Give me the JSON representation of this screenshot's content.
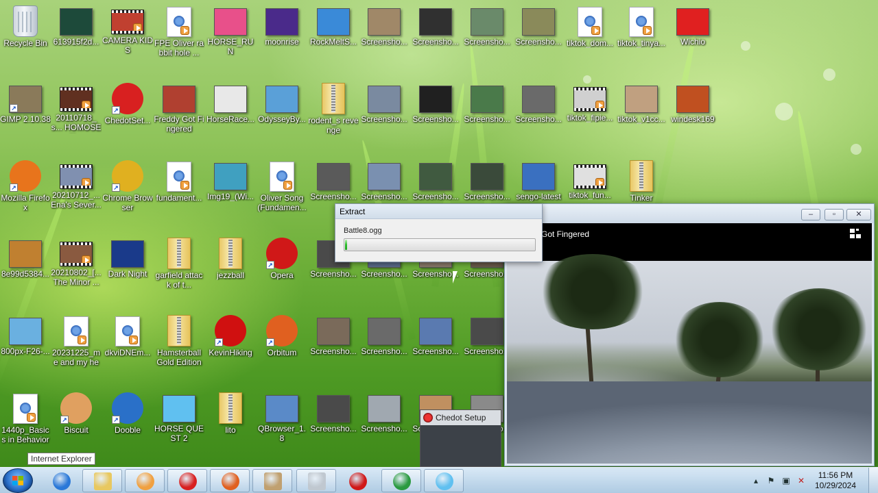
{
  "desktop": {
    "icons": [
      {
        "label": "Recycle Bin",
        "kind": "bin",
        "color": "#d8dee6"
      },
      {
        "label": "613915f2d...",
        "kind": "thumb",
        "color": "#1d4a3a"
      },
      {
        "label": "CAMERA KIDS",
        "kind": "video",
        "color": "#c04030"
      },
      {
        "label": "FPE Oliver rabbit hole ...",
        "kind": "doc",
        "color": "#ffffff"
      },
      {
        "label": "HORSE_RUN",
        "kind": "thumb",
        "color": "#e8508a"
      },
      {
        "label": "moonrise",
        "kind": "thumb",
        "color": "#4a2a8a"
      },
      {
        "label": "RockMeltS...",
        "kind": "thumb",
        "color": "#3a8ad8"
      },
      {
        "label": "Screensho...",
        "kind": "thumb",
        "color": "#a08868"
      },
      {
        "label": "Screensho...",
        "kind": "thumb",
        "color": "#303030"
      },
      {
        "label": "Screensho...",
        "kind": "thumb",
        "color": "#6a8a6a"
      },
      {
        "label": "Screensho...",
        "kind": "thumb",
        "color": "#8a8a5a"
      },
      {
        "label": "tiktok_dom...",
        "kind": "doc",
        "color": "#ffffff"
      },
      {
        "label": "tiktok_tinya...",
        "kind": "doc",
        "color": "#ffffff"
      },
      {
        "label": "Wichio",
        "kind": "thumb",
        "color": "#e02020"
      },
      {
        "label": "GIMP 2.10.38",
        "kind": "thumb",
        "color": "#8a7a5a"
      },
      {
        "label": "20110718_s... HOMOSEX...",
        "kind": "video",
        "color": "#603020"
      },
      {
        "label": "ChedotSet...",
        "kind": "round",
        "color": "#d82020"
      },
      {
        "label": "Freddy Got Fingered",
        "kind": "thumb",
        "color": "#b04030"
      },
      {
        "label": "HorseRace...",
        "kind": "thumb",
        "color": "#e8e8e8"
      },
      {
        "label": "OdysseyBy...",
        "kind": "thumb",
        "color": "#5aa0d8"
      },
      {
        "label": "rodent_s revenge",
        "kind": "folder",
        "color": "#f0d080"
      },
      {
        "label": "Screensho...",
        "kind": "thumb",
        "color": "#7a8aa0"
      },
      {
        "label": "Screensho...",
        "kind": "thumb",
        "color": "#202020"
      },
      {
        "label": "Screensho...",
        "kind": "thumb",
        "color": "#4a7a4a"
      },
      {
        "label": "Screensho...",
        "kind": "thumb",
        "color": "#6a6a6a"
      },
      {
        "label": "tiktok_fipie...",
        "kind": "video",
        "color": "#d0d0d0"
      },
      {
        "label": "tiktok_v1cc...",
        "kind": "thumb",
        "color": "#c0a080"
      },
      {
        "label": "windesk169",
        "kind": "thumb",
        "color": "#c05020"
      },
      {
        "label": "Mozilla Firefox",
        "kind": "round",
        "color": "#e8741c"
      },
      {
        "label": "20210712_... Ena's Sever...",
        "kind": "video",
        "color": "#8090b0"
      },
      {
        "label": "Chrome Browser",
        "kind": "round",
        "color": "#e0b020"
      },
      {
        "label": "fundament...",
        "kind": "doc",
        "color": "#ffffff"
      },
      {
        "label": "Img19_(Wi...",
        "kind": "thumb",
        "color": "#40a0c0"
      },
      {
        "label": "Oliver Song (Fundamen...",
        "kind": "doc",
        "color": "#ffffff"
      },
      {
        "label": "Screensho...",
        "kind": "thumb",
        "color": "#5a5a5a"
      },
      {
        "label": "Screensho...",
        "kind": "thumb",
        "color": "#7a90b0"
      },
      {
        "label": "Screensho...",
        "kind": "thumb",
        "color": "#405a40"
      },
      {
        "label": "Screensho...",
        "kind": "thumb",
        "color": "#3a4a3a"
      },
      {
        "label": "sengo-latest",
        "kind": "thumb",
        "color": "#3a70c0"
      },
      {
        "label": "tiktok_fun...",
        "kind": "video",
        "color": "#e0e0e0"
      },
      {
        "label": "Tinker",
        "kind": "folder",
        "color": "#f0d080"
      },
      {
        "label": "8e99d5384...",
        "kind": "thumb",
        "color": "#c08030"
      },
      {
        "label": "20210802_[... The Minor ...",
        "kind": "video",
        "color": "#8a5a40"
      },
      {
        "label": "Dark Night",
        "kind": "thumb",
        "color": "#1a3a8a"
      },
      {
        "label": "garfield attack of t...",
        "kind": "folder",
        "color": "#f0d080"
      },
      {
        "label": "jezzball",
        "kind": "folder",
        "color": "#f0d080"
      },
      {
        "label": "Opera",
        "kind": "round",
        "color": "#d01818"
      },
      {
        "label": "Screensho...",
        "kind": "thumb",
        "color": "#4a4a4a"
      },
      {
        "label": "Screensho...",
        "kind": "thumb",
        "color": "#5a6a8a"
      },
      {
        "label": "Screensho...",
        "kind": "thumb",
        "color": "#8a7a6a"
      },
      {
        "label": "Screensho...",
        "kind": "thumb",
        "color": "#6a5a4a"
      },
      {
        "label": "800px-F26-...",
        "kind": "thumb",
        "color": "#6ab0e0"
      },
      {
        "label": "20231225_me and my het...",
        "kind": "doc",
        "color": "#ffffff"
      },
      {
        "label": "dkviDNEm...",
        "kind": "doc",
        "color": "#ffffff"
      },
      {
        "label": "Hamsterball Gold Edition",
        "kind": "folder",
        "color": "#f0d080"
      },
      {
        "label": "KevinHiking",
        "kind": "round",
        "color": "#d01010"
      },
      {
        "label": "Orbitum",
        "kind": "round",
        "color": "#e06020"
      },
      {
        "label": "Screensho...",
        "kind": "thumb",
        "color": "#7a6a5a"
      },
      {
        "label": "Screensho...",
        "kind": "thumb",
        "color": "#6a6a6a"
      },
      {
        "label": "Screensho...",
        "kind": "thumb",
        "color": "#5a7ab0"
      },
      {
        "label": "Screensho...",
        "kind": "thumb",
        "color": "#4a4a4a"
      },
      {
        "label": "1440p_Basics in Behavior",
        "kind": "doc",
        "color": "#ffffff"
      },
      {
        "label": "Biscuit",
        "kind": "round",
        "color": "#e0a060"
      },
      {
        "label": "Dooble",
        "kind": "round",
        "color": "#2a70c8"
      },
      {
        "label": "HORSE QUEST 2",
        "kind": "thumb",
        "color": "#60c0f0"
      },
      {
        "label": "lito",
        "kind": "folder",
        "color": "#f0d080"
      },
      {
        "label": "QBrowser_1.8",
        "kind": "thumb",
        "color": "#5a8ac8"
      },
      {
        "label": "Screensho...",
        "kind": "thumb",
        "color": "#4a4a4a"
      },
      {
        "label": "Screensho...",
        "kind": "thumb",
        "color": "#a0a8b0"
      },
      {
        "label": "Screensho...",
        "kind": "thumb",
        "color": "#c09060"
      },
      {
        "label": "Screensho...",
        "kind": "thumb",
        "color": "#8a8a8a"
      }
    ]
  },
  "extract_dialog": {
    "title": "Extract",
    "filename": "Battle8.ogg",
    "progress": 0.01,
    "progress_color": "#2dbb2d"
  },
  "player": {
    "title": "Got Fingered",
    "buttons": {
      "minimize": "‒",
      "maximize": "▫",
      "close": "✕"
    }
  },
  "chedot_setup": {
    "title": "Chedot Setup"
  },
  "tooltip": {
    "text": "Internet Explorer"
  },
  "taskbar": {
    "buttons": [
      {
        "name": "internet-explorer",
        "active": false,
        "color": "#2a78d8"
      },
      {
        "name": "file-explorer",
        "active": true,
        "color": "#e8c860"
      },
      {
        "name": "media-player",
        "active": true,
        "color": "#f0a040"
      },
      {
        "name": "chedot",
        "active": true,
        "color": "#d82020"
      },
      {
        "name": "orbitum",
        "active": true,
        "color": "#e06020"
      },
      {
        "name": "extract-app",
        "active": true,
        "color": "#c0a070"
      },
      {
        "name": "blank-app",
        "active": true,
        "color": "#c0c8d0"
      },
      {
        "name": "opera",
        "active": false,
        "color": "#d01818"
      },
      {
        "name": "chrome",
        "active": true,
        "color": "#2a9a40"
      },
      {
        "name": "horse-quest",
        "active": true,
        "color": "#60c0f0"
      }
    ],
    "tray": {
      "time": "11:56 PM",
      "date": "10/29/2024"
    }
  }
}
